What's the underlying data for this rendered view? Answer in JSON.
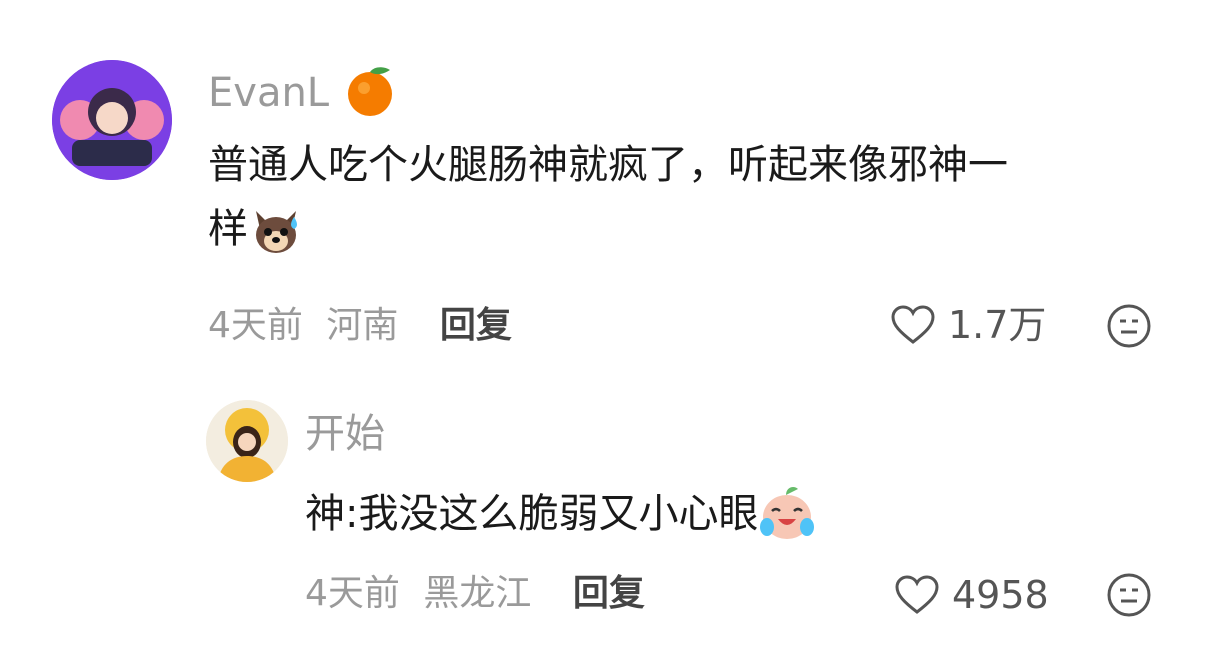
{
  "comments": [
    {
      "username": "EvanL",
      "text_line1": "普通人吃个火腿肠神就疯了，听起来像邪神一",
      "text_line2": "样",
      "time": "4天前",
      "location": "河南",
      "reply_label": "回复",
      "likes": "1.7万"
    },
    {
      "username": "开始",
      "text": "神:我没这么脆弱又小心眼",
      "time": "4天前",
      "location": "黑龙江",
      "reply_label": "回复",
      "likes": "4958"
    }
  ],
  "colors": {
    "meta": "#9a9a9a",
    "text": "#1a1a1a",
    "avatar1_bg": "#7b3fe4"
  },
  "icons": [
    "heart-outline-icon",
    "neutral-face-icon",
    "tangerine-emoji",
    "dog-sweat-emoji",
    "crying-laugh-emoji"
  ]
}
